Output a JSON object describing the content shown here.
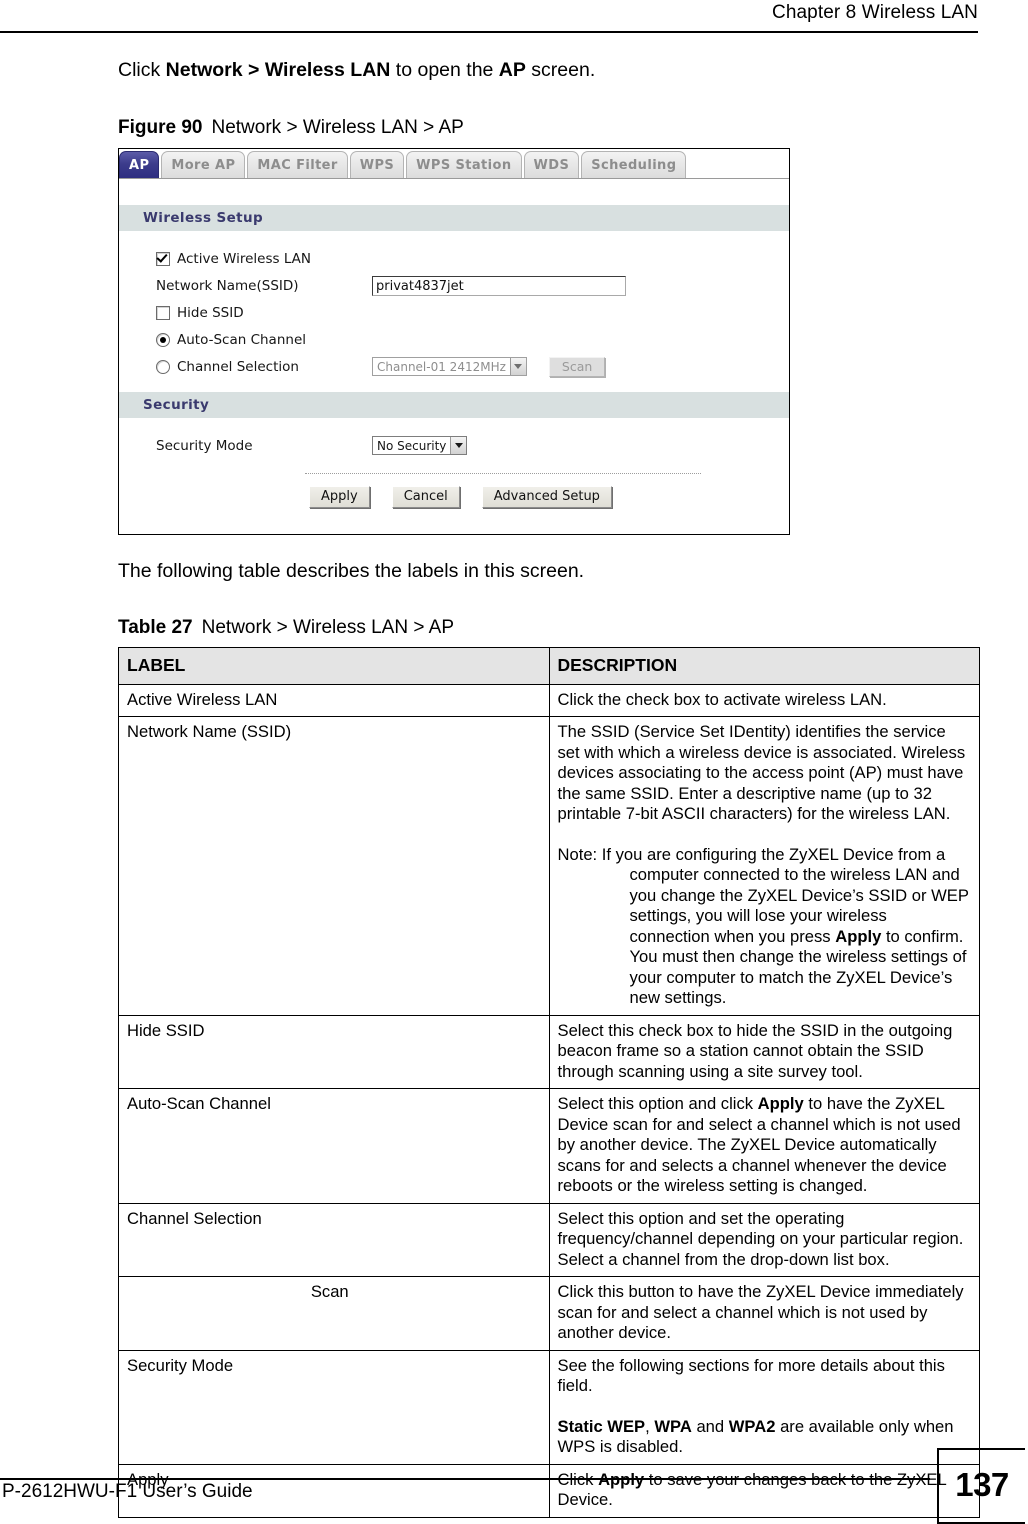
{
  "header": {
    "chapter_title": "Chapter 8 Wireless LAN"
  },
  "intro": {
    "prefix": "Click ",
    "bold_path": "Network > Wireless LAN",
    "middle": " to open the ",
    "bold_screen": "AP",
    "suffix": " screen."
  },
  "figure": {
    "caption_label": "Figure 90",
    "caption_text": "Network > Wireless LAN > AP",
    "tabs": [
      {
        "label": "AP",
        "active": true
      },
      {
        "label": "More AP",
        "active": false
      },
      {
        "label": "MAC Filter",
        "active": false
      },
      {
        "label": "WPS",
        "active": false
      },
      {
        "label": "WPS Station",
        "active": false
      },
      {
        "label": "WDS",
        "active": false
      },
      {
        "label": "Scheduling",
        "active": false
      }
    ],
    "wireless_setup": {
      "section_title": "Wireless Setup",
      "active_wireless_lan_label": "Active Wireless LAN",
      "active_wireless_lan_checked": true,
      "ssid_label": "Network Name(SSID)",
      "ssid_value": "privat4837jet",
      "hide_ssid_label": "Hide SSID",
      "hide_ssid_checked": false,
      "auto_scan_label": "Auto-Scan Channel",
      "auto_scan_selected": true,
      "channel_selection_label": "Channel Selection",
      "channel_selection_selected": false,
      "channel_value": "Channel-01 2412MHz",
      "scan_button": "Scan"
    },
    "security": {
      "section_title": "Security",
      "security_mode_label": "Security Mode",
      "security_mode_value": "No Security"
    },
    "buttons": {
      "apply": "Apply",
      "cancel": "Cancel",
      "advanced_setup": "Advanced Setup"
    },
    "colors": {
      "active_tab": "#2e2e80",
      "section_bar": "#d8e0e0",
      "section_text": "#3a3a6e"
    }
  },
  "after_figure_text": "The following table describes the labels in this screen.",
  "table": {
    "caption_label": "Table 27",
    "caption_text": "Network > Wireless LAN > AP",
    "columns": [
      "LABEL",
      "DESCRIPTION"
    ],
    "rows": [
      {
        "label": "Active Wireless LAN",
        "indent": false,
        "paragraphs": [
          {
            "text": "Click the check box to activate wireless LAN."
          }
        ]
      },
      {
        "label": "Network Name (SSID)",
        "indent": false,
        "paragraphs": [
          {
            "text": "The SSID (Service Set IDentity) identifies the service set with which a wireless device is associated. Wireless devices associating to the access point (AP) must have the same SSID. Enter a descriptive name (up to 32 printable 7-bit ASCII characters) for the wireless LAN."
          },
          {
            "note": true,
            "note_prefix": "Note: ",
            "before_bold": "If you are configuring the ZyXEL Device from a computer connected to the wireless LAN and you change the ZyXEL Device’s SSID or WEP settings, you will lose your wireless connection when you press ",
            "bold": "Apply",
            "after_bold": " to confirm. You must then change the wireless settings of your computer to match the ZyXEL Device’s new settings."
          }
        ]
      },
      {
        "label": "Hide SSID",
        "indent": false,
        "paragraphs": [
          {
            "text": "Select this check box to hide the SSID in the outgoing beacon frame so a station cannot obtain the SSID through scanning using a site survey tool."
          }
        ]
      },
      {
        "label": "Auto-Scan Channel",
        "indent": false,
        "paragraphs": [
          {
            "before_bold": "Select this option and click ",
            "bold": "Apply",
            "after_bold": " to have the ZyXEL Device scan for and select a channel which is not used by another device.  The ZyXEL Device automatically scans for and selects a channel whenever the device reboots or the wireless setting is changed."
          }
        ]
      },
      {
        "label": "Channel Selection",
        "indent": false,
        "paragraphs": [
          {
            "text": "Select this option and set the operating frequency/channel depending on your particular region. Select a channel from the drop-down list box."
          }
        ]
      },
      {
        "label": "Scan",
        "indent": true,
        "paragraphs": [
          {
            "text": "Click this button to have the ZyXEL Device immediately scan for and select a channel which is not used by another device."
          }
        ]
      },
      {
        "label": "Security Mode",
        "indent": false,
        "paragraphs": [
          {
            "text": "See the following sections for more details about this field."
          },
          {
            "bold_lead": "Static WEP",
            "mid1": ", ",
            "bold2": "WPA",
            "mid2": " and ",
            "bold3": "WPA2",
            "tail": " are available only when WPS is disabled."
          }
        ]
      },
      {
        "label": "Apply",
        "indent": false,
        "paragraphs": [
          {
            "before_bold": "Click ",
            "bold": "Apply",
            "after_bold": " to save your changes back to the ZyXEL Device."
          }
        ]
      }
    ]
  },
  "footer": {
    "guide_title": "P-2612HWU-F1 User’s Guide",
    "page_number": "137"
  }
}
